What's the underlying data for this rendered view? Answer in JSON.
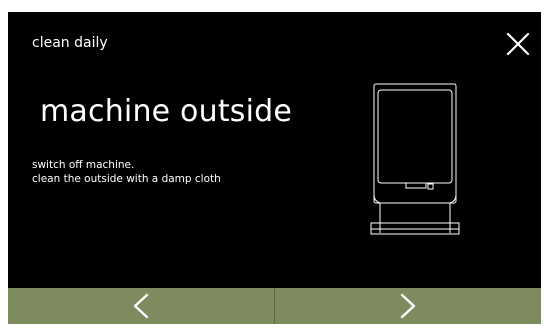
{
  "header": {
    "section_title": "clean daily",
    "close_icon": "close-x-icon"
  },
  "content": {
    "heading": "machine outside",
    "instructions": [
      "switch off machine.",
      "clean the outside with a damp cloth"
    ],
    "illustration": "machine-front-outline-icon"
  },
  "navigation": {
    "prev_icon": "chevron-left-icon",
    "next_icon": "chevron-right-icon"
  },
  "colors": {
    "background": "#000000",
    "text": "#ffffff",
    "nav_button": "#7d8b5e"
  }
}
